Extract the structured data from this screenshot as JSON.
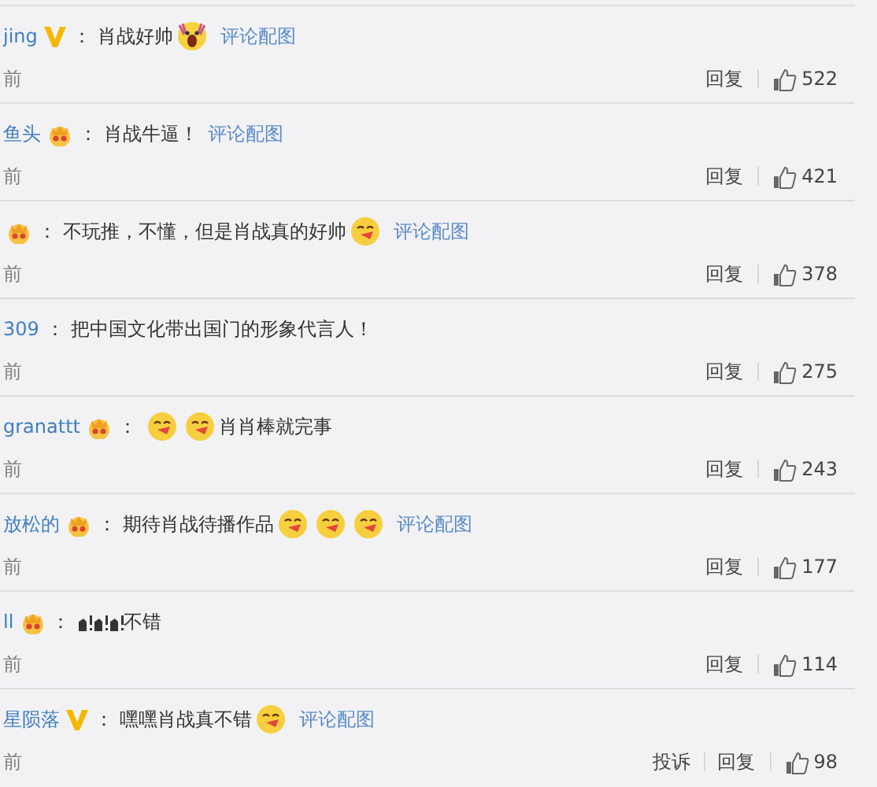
{
  "comments": [
    {
      "user": "jing",
      "verified": true,
      "crown": false,
      "separator": "：",
      "content": [
        {
          "kind": "text",
          "text": "肖战好帅"
        },
        {
          "kind": "shock"
        }
      ],
      "link": "评论配图",
      "time": "前",
      "reply": "回复",
      "likes": "522"
    },
    {
      "user": "鱼头",
      "verified": false,
      "crown": true,
      "separator": "：",
      "content": [
        {
          "kind": "text",
          "text": "肖战牛逼！"
        }
      ],
      "link": "评论配图",
      "time": "前",
      "reply": "回复",
      "likes": "421"
    },
    {
      "verified": false,
      "crown": true,
      "separator": "：",
      "content": [
        {
          "kind": "text",
          "text": "不玩推，不懂，但是肖战真的好帅"
        },
        {
          "kind": "kiss"
        }
      ],
      "link": "评论配图",
      "time": "前",
      "reply": "回复",
      "likes": "378"
    },
    {
      "user": "309",
      "verified": false,
      "crown": false,
      "separator": "：",
      "content": [
        {
          "kind": "text",
          "text": "把中国文化带出国门的形象代言人！"
        }
      ],
      "time": "前",
      "reply": "回复",
      "likes": "275"
    },
    {
      "user": "granattt",
      "verified": false,
      "crown": true,
      "separator": "：",
      "content": [
        {
          "kind": "kiss"
        },
        {
          "kind": "kiss"
        },
        {
          "kind": "text",
          "text": "肖肖棒就完事"
        }
      ],
      "time": "前",
      "reply": "回复",
      "likes": "243"
    },
    {
      "user": "放松的",
      "verified": false,
      "crown": true,
      "separator": "：",
      "content": [
        {
          "kind": "text",
          "text": "期待肖战待播作品"
        },
        {
          "kind": "kiss"
        },
        {
          "kind": "kiss"
        },
        {
          "kind": "kiss"
        }
      ],
      "link": "评论配图",
      "time": "前",
      "reply": "回复",
      "likes": "177"
    },
    {
      "user": "ll",
      "verified": false,
      "crown": true,
      "separator": "：",
      "content": [
        {
          "kind": "glyph"
        },
        {
          "kind": "glyph"
        },
        {
          "kind": "glyph"
        },
        {
          "kind": "text",
          "text": "不错"
        }
      ],
      "time": "前",
      "reply": "回复",
      "likes": "114"
    },
    {
      "user": "星陨落",
      "verified": true,
      "crown": false,
      "separator": "：",
      "content": [
        {
          "kind": "text",
          "text": "嘿嘿肖战真不错"
        },
        {
          "kind": "kiss"
        }
      ],
      "link": "评论配图",
      "time": "前",
      "report": "投诉",
      "reply": "回复",
      "likes": "98"
    }
  ]
}
